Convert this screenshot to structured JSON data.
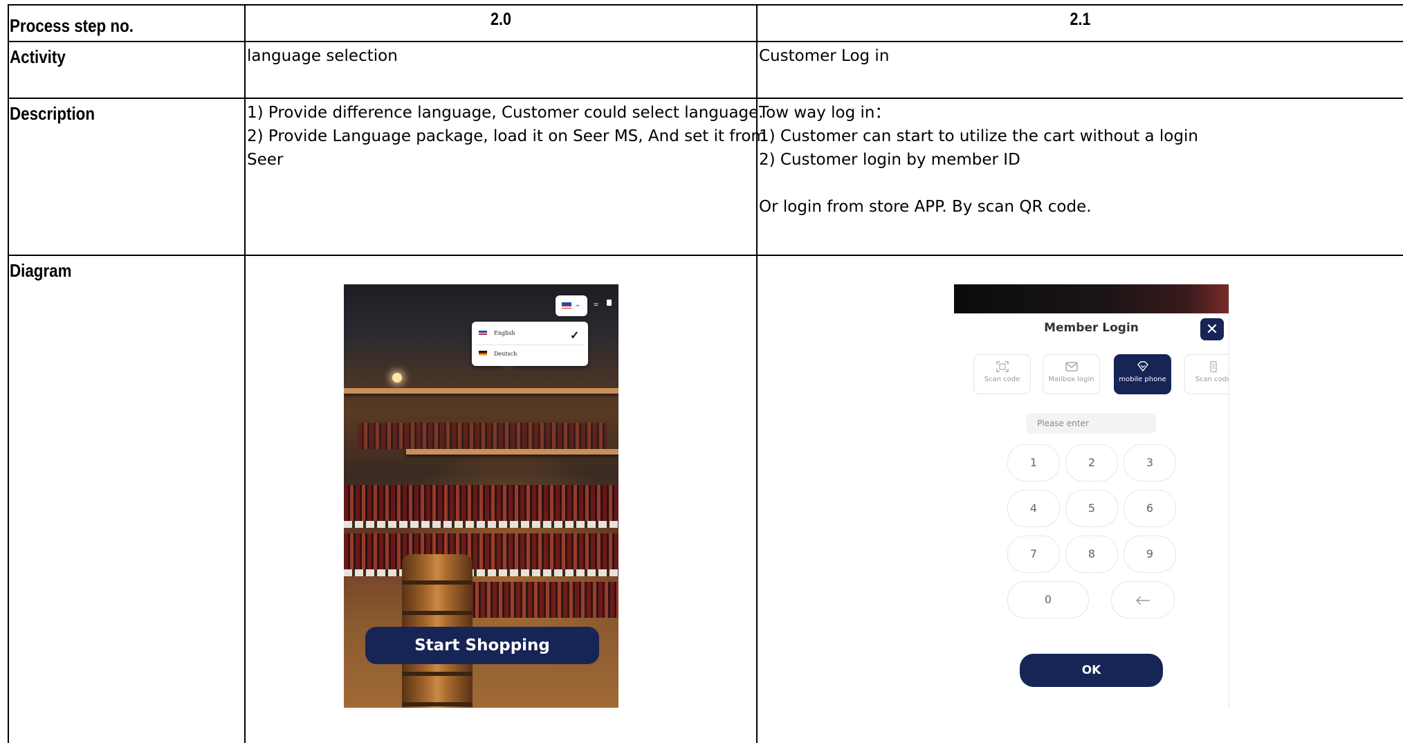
{
  "table": {
    "row_labels": {
      "step": "Process step no.",
      "activity": "Activity",
      "description": "Description",
      "diagram": "Diagram"
    },
    "columns": [
      {
        "step": "2.0",
        "activity": "language selection",
        "description_lines": [
          "1) Provide difference language, Customer could select language.",
          "2) Provide Language package, load it on Seer MS, And set it from",
          "Seer"
        ]
      },
      {
        "step": "2.1",
        "activity": "Customer Log in",
        "description_lines": [
          "Tow way log in：",
          "1) Customer can start to utilize the cart without a login",
          "2) Customer login by member ID",
          "",
          "Or login from store APP. By scan QR code."
        ]
      }
    ]
  },
  "diagram_1": {
    "language_options": [
      "English",
      "Deutsch"
    ],
    "selected_language": "English",
    "start_button": "Start  Shopping",
    "accent_color": "#162456"
  },
  "diagram_2": {
    "title": "Member Login",
    "tabs": [
      {
        "label": "Scan code",
        "icon": "scan-icon",
        "active": false
      },
      {
        "label": "Mailbox login",
        "icon": "mail-icon",
        "active": false
      },
      {
        "label": "mobile phone",
        "icon": "diamond-icon",
        "active": true
      },
      {
        "label": "Scan code",
        "icon": "phone-icon",
        "active": false
      }
    ],
    "input_placeholder": "Please enter",
    "keypad": [
      "1",
      "2",
      "3",
      "4",
      "5",
      "6",
      "7",
      "8",
      "9",
      "0"
    ],
    "ok_label": "OK",
    "accent_color": "#162456"
  }
}
